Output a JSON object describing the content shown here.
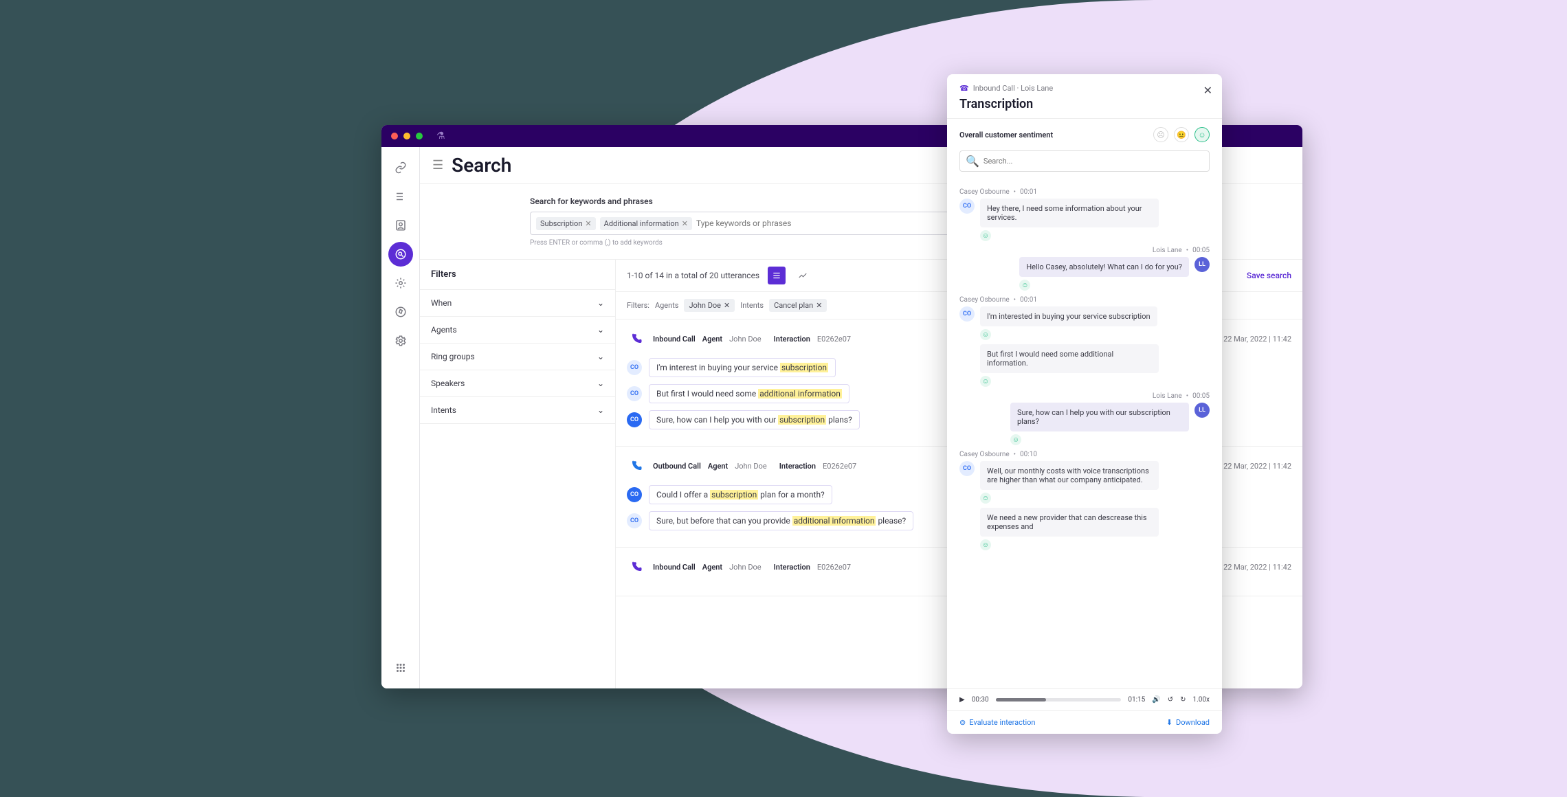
{
  "search": {
    "pageTitle": "Search",
    "label": "Search for keywords and phrases",
    "placeholder": "Type keywords or phrases",
    "hint": "Press ENTER or comma (,) to add keywords",
    "tags": [
      "Subscription",
      "Additional information"
    ]
  },
  "filters": {
    "title": "Filters",
    "items": [
      "When",
      "Agents",
      "Ring groups",
      "Speakers",
      "Intents"
    ]
  },
  "results": {
    "countText": "1-10 of 14 in a total of 20 utterances",
    "saveSearch": "Save search",
    "chipsLabel": "Filters:",
    "chipGroups": [
      {
        "label": "Agents",
        "value": "John Doe"
      },
      {
        "label": "Intents",
        "value": "Cancel plan"
      }
    ],
    "cards": [
      {
        "type": "Inbound Call",
        "agentLabel": "Agent",
        "agent": "John Doe",
        "interactionLabel": "Interaction",
        "interaction": "E0262e07",
        "datetime": "22 Mar, 2022 | 11:42",
        "utterances": [
          {
            "av": "co",
            "textA": "I'm interest in buying your service ",
            "hl": "subscription",
            "textB": ""
          },
          {
            "av": "co",
            "textA": "But first I would need some ",
            "hl": "additional information",
            "textB": ""
          },
          {
            "av": "coa",
            "textA": "Sure, how can I help you with our ",
            "hl": "subscription",
            "textB": " plans?"
          }
        ]
      },
      {
        "type": "Outbound Call",
        "agentLabel": "Agent",
        "agent": "John Doe",
        "interactionLabel": "Interaction",
        "interaction": "E0262e07",
        "datetime": "22 Mar, 2022 | 11:42",
        "utterances": [
          {
            "av": "coa",
            "textA": "Could I offer a ",
            "hl": "subscription",
            "textB": " plan for a month?"
          },
          {
            "av": "co",
            "textA": "Sure, but before that can you provide ",
            "hl": "additional information",
            "textB": " please?"
          }
        ]
      },
      {
        "type": "Inbound Call",
        "agentLabel": "Agent",
        "agent": "John Doe",
        "interactionLabel": "Interaction",
        "interaction": "E0262e07",
        "datetime": "22 Mar, 2022 | 11:42",
        "utterances": []
      }
    ]
  },
  "panel": {
    "meta": "Inbound Call · Lois Lane",
    "title": "Transcription",
    "sentimentLabel": "Overall customer sentiment",
    "searchPlaceholder": "Search...",
    "messages": [
      {
        "who": "Casey Osbourne",
        "init": "CO",
        "side": "left",
        "time": "00:01",
        "text": "Hey there, I need some information about your services."
      },
      {
        "who": "Lois Lane",
        "init": "LL",
        "side": "right",
        "time": "00:05",
        "text": "Hello Casey, absolutely! What can I do for you?"
      },
      {
        "who": "Casey Osbourne",
        "init": "CO",
        "side": "left",
        "time": "00:01",
        "text": "I'm interested in buying your service subscription"
      },
      {
        "who": "",
        "init": "",
        "side": "left-cont",
        "time": "",
        "text": "But first I would need some additional information."
      },
      {
        "who": "Lois Lane",
        "init": "LL",
        "side": "right",
        "time": "00:05",
        "text": "Sure, how can I help you with our subscription plans?"
      },
      {
        "who": "Casey Osbourne",
        "init": "CO",
        "side": "left",
        "time": "00:10",
        "text": "Well, our monthly costs with voice transcriptions are higher than what our company anticipated."
      },
      {
        "who": "",
        "init": "",
        "side": "left-cont",
        "time": "",
        "text": "We need a new provider that can descrease this expenses and"
      }
    ],
    "player": {
      "cur": "00:30",
      "dur": "01:15",
      "speed": "1.00x"
    },
    "footer": {
      "evaluate": "Evaluate interaction",
      "download": "Download"
    }
  }
}
